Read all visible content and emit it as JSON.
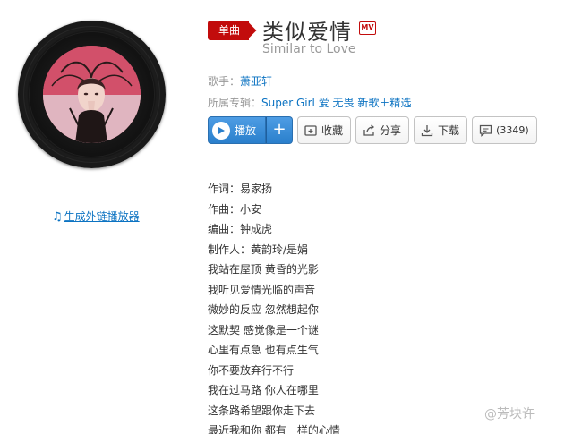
{
  "song": {
    "tag": "单曲",
    "title": "类似爱情",
    "mv_badge": "MV",
    "alias": "Similar to Love",
    "singer_label": "歌手：",
    "singer": "萧亚轩",
    "album_label": "所属专辑：",
    "album": "Super Girl 爱 无畏 新歌＋精选"
  },
  "actions": {
    "play": "播放",
    "add": "+",
    "collect": "收藏",
    "share": "分享",
    "download": "下载",
    "comments": "(3349)"
  },
  "embed_link": "生成外链播放器",
  "lyrics": [
    "作词：易家扬",
    "作曲：小安",
    "编曲：钟成虎",
    "制作人：黄韵玲/是娟",
    "我站在屋顶 黄昏的光影",
    "我听见爱情光临的声音",
    "微妙的反应 忽然想起你",
    "这默契 感觉像是一个谜",
    "心里有点急 也有点生气",
    "你不要放弃行不行",
    "我在过马路 你人在哪里",
    "这条路希望跟你走下去",
    "最近我和你 都有一样的心情"
  ],
  "watermark": "@芳块许",
  "colors": {
    "tag_red": "#c20c0c",
    "link_blue": "#0c73c2",
    "play_blue": "#2a7fcc"
  },
  "icons": [
    "music-note-icon",
    "mv-icon",
    "play-icon",
    "collect-icon",
    "share-icon",
    "download-icon",
    "comment-icon"
  ]
}
